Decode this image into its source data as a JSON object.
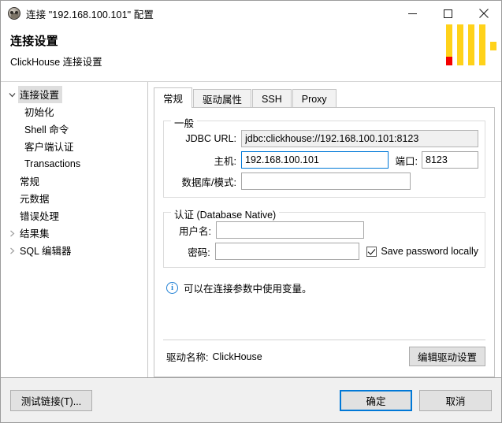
{
  "window": {
    "title": "连接 \"192.168.100.101\" 配置",
    "icon": "dbeaver-app-icon",
    "controls": {
      "minimize": "minimize-icon",
      "maximize": "maximize-icon",
      "close": "close-icon"
    }
  },
  "header": {
    "title": "连接设置",
    "subtitle": "ClickHouse 连接设置",
    "decoration": {
      "bar_color": "#ffd21a",
      "accent_color": "#f40000"
    }
  },
  "sidebar": {
    "items": [
      {
        "label": "连接设置",
        "level": 1,
        "twisty": "expanded",
        "selected": true
      },
      {
        "label": "初始化",
        "level": 2,
        "twisty": "none",
        "selected": false
      },
      {
        "label": "Shell 命令",
        "level": 2,
        "twisty": "none",
        "selected": false
      },
      {
        "label": "客户端认证",
        "level": 2,
        "twisty": "none",
        "selected": false
      },
      {
        "label": "Transactions",
        "level": 2,
        "twisty": "none",
        "selected": false
      },
      {
        "label": "常规",
        "level": 1,
        "twisty": "none",
        "selected": false
      },
      {
        "label": "元数据",
        "level": 1,
        "twisty": "none",
        "selected": false
      },
      {
        "label": "错误处理",
        "level": 1,
        "twisty": "none",
        "selected": false
      },
      {
        "label": "结果集",
        "level": 1,
        "twisty": "collapsed",
        "selected": false
      },
      {
        "label": "SQL 编辑器",
        "level": 1,
        "twisty": "collapsed",
        "selected": false
      }
    ]
  },
  "main": {
    "tabs": [
      {
        "label": "常规",
        "active": true
      },
      {
        "label": "驱动属性",
        "active": false
      },
      {
        "label": "SSH",
        "active": false
      },
      {
        "label": "Proxy",
        "active": false
      }
    ],
    "general_group": {
      "legend": "一般",
      "jdbc_url_label": "JDBC URL:",
      "jdbc_url_value": "jdbc:clickhouse://192.168.100.101:8123",
      "host_label": "主机:",
      "host_value": "192.168.100.101",
      "host_placeholder": "",
      "port_label": "端口:",
      "port_value": "8123",
      "database_label": "数据库/模式:",
      "database_value": "",
      "database_placeholder": ""
    },
    "auth_group": {
      "legend": "认证 (Database Native)",
      "username_label": "用户名:",
      "username_value": "",
      "username_placeholder": "",
      "password_label": "密码:",
      "password_value": "",
      "password_placeholder": "",
      "save_password_label": "Save password locally",
      "save_password_checked": true
    },
    "info": {
      "icon": "info-icon",
      "text": "可以在连接参数中使用变量。"
    },
    "driver": {
      "label": "驱动名称:",
      "name": "ClickHouse",
      "edit_button": "编辑驱动设置"
    }
  },
  "footer": {
    "test_button": "测试链接(T)...",
    "ok_button": "确定",
    "cancel_button": "取消",
    "focus_color": "#0078d7"
  }
}
